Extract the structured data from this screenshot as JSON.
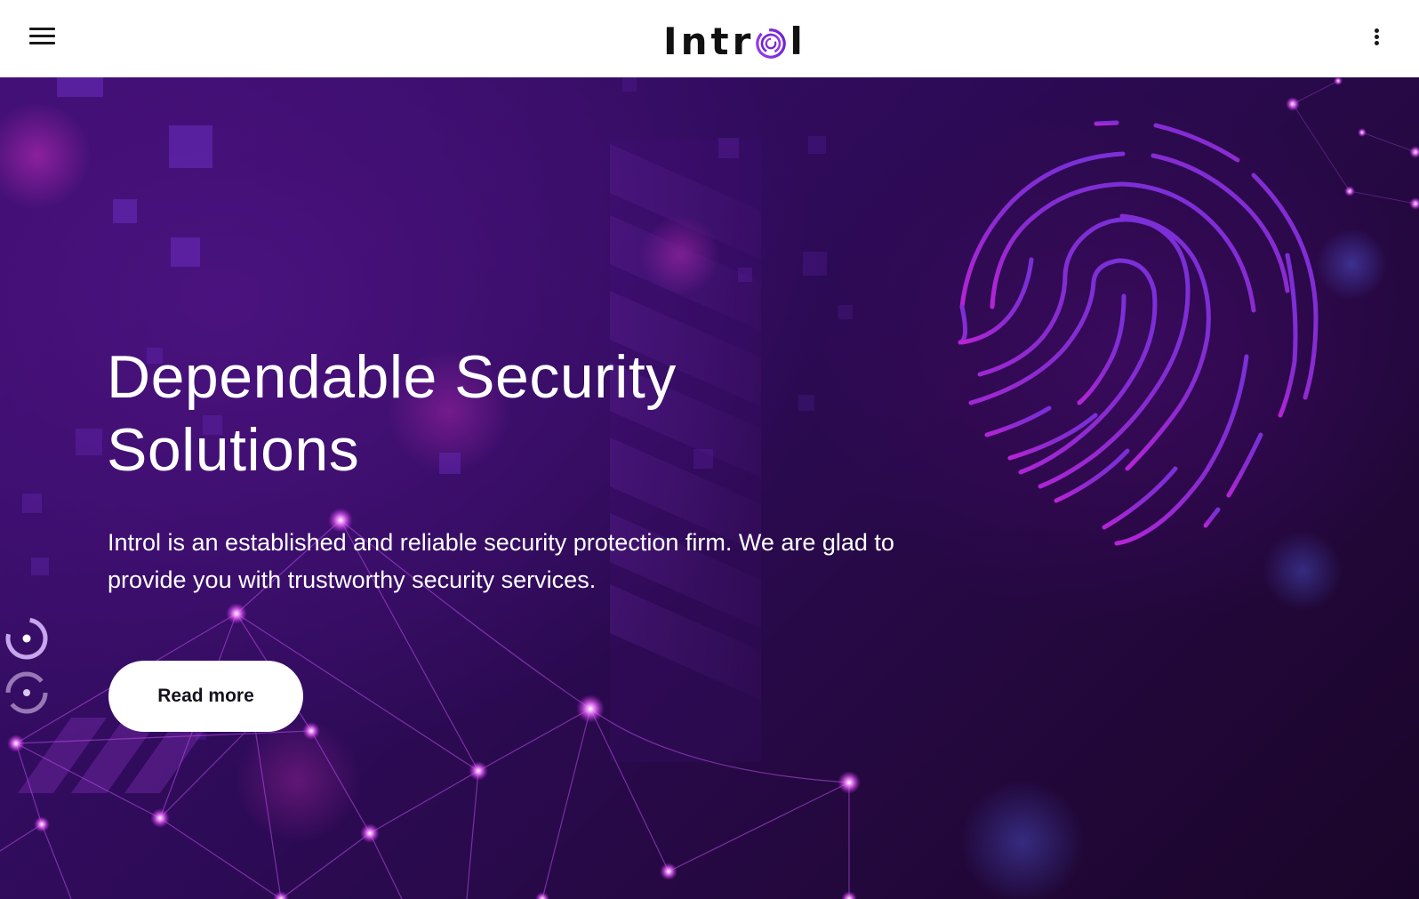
{
  "header": {
    "menu_icon": "hamburger-menu-icon",
    "logo": {
      "prefix": "Intr",
      "suffix": "l",
      "o_icon": "fingerprint-o-icon"
    },
    "more_icon": "vertical-dots-icon"
  },
  "hero": {
    "title_line1": "Dependable Security",
    "title_line2": "Solutions",
    "description": "Introl is an established and reliable security protection firm. We are glad to provide you with trustworthy security services.",
    "cta_label": "Read more",
    "decor_icon": "fingerprint-icon",
    "slider": {
      "count": 2,
      "active_index": 0
    }
  },
  "colors": {
    "brand_purple": "#7b2fd8",
    "hero_bg_top": "#3d0f72",
    "hero_bg_bottom": "#1a0529",
    "accent_pink": "#e040fb",
    "header_text": "#111111",
    "button_bg": "#ffffff",
    "button_text": "#15121e"
  }
}
